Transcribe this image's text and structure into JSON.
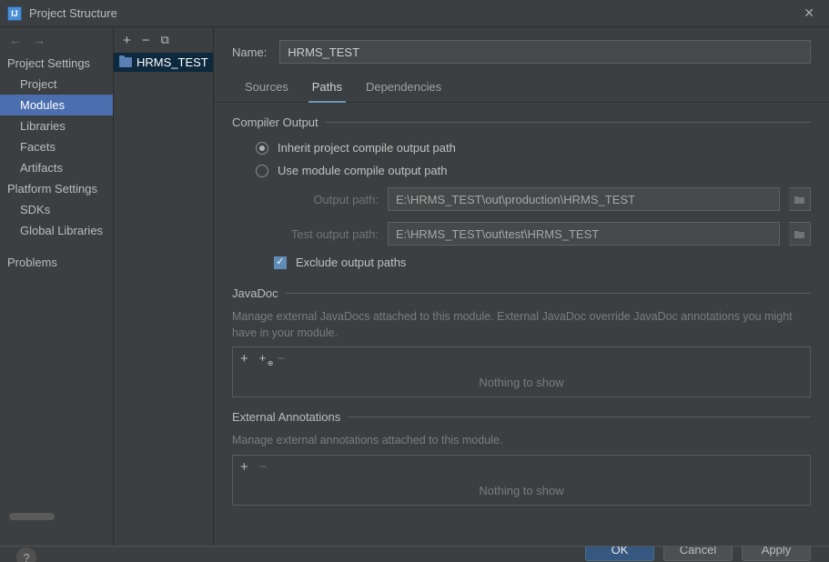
{
  "window": {
    "title": "Project Structure"
  },
  "nav": {
    "headings": {
      "project": "Project Settings",
      "platform": "Platform Settings"
    },
    "items": {
      "project": "Project",
      "modules": "Modules",
      "libraries": "Libraries",
      "facets": "Facets",
      "artifacts": "Artifacts",
      "sdks": "SDKs",
      "global_libs": "Global Libraries",
      "problems": "Problems"
    }
  },
  "module_list": {
    "items": [
      {
        "name": "HRMS_TEST"
      }
    ]
  },
  "main": {
    "name_label": "Name:",
    "name_value": "HRMS_TEST",
    "tabs": {
      "sources": "Sources",
      "paths": "Paths",
      "dependencies": "Dependencies"
    },
    "compiler": {
      "title": "Compiler Output",
      "inherit": "Inherit project compile output path",
      "use_module": "Use module compile output path",
      "output_label": "Output path:",
      "output_value": "E:\\HRMS_TEST\\out\\production\\HRMS_TEST",
      "test_label": "Test output path:",
      "test_value": "E:\\HRMS_TEST\\out\\test\\HRMS_TEST",
      "exclude": "Exclude output paths"
    },
    "javadoc": {
      "title": "JavaDoc",
      "desc": "Manage external JavaDocs attached to this module. External JavaDoc override JavaDoc annotations you might have in your module.",
      "empty": "Nothing to show"
    },
    "annotations": {
      "title": "External Annotations",
      "desc": "Manage external annotations attached to this module.",
      "empty": "Nothing to show"
    }
  },
  "buttons": {
    "ok": "OK",
    "cancel": "Cancel",
    "apply": "Apply"
  }
}
